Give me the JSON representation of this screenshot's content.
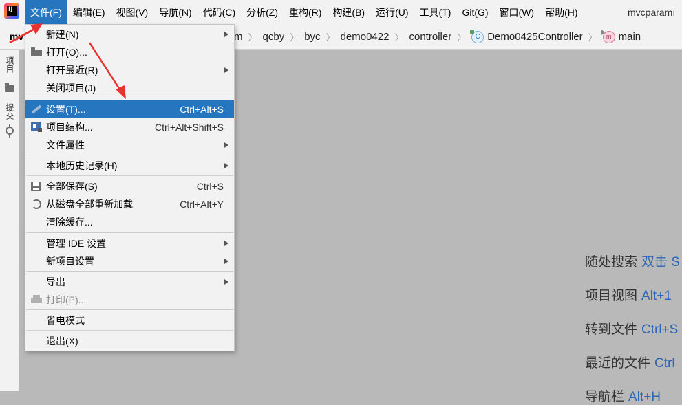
{
  "menubar": {
    "items": [
      "文件(F)",
      "编辑(E)",
      "视图(V)",
      "导航(N)",
      "代码(C)",
      "分析(Z)",
      "重构(R)",
      "构建(B)",
      "运行(U)",
      "工具(T)",
      "Git(G)",
      "窗口(W)",
      "帮助(H)"
    ],
    "active_index": 0,
    "project_name": "mvcparamı"
  },
  "breadcrumb": {
    "lead": "mv",
    "items": [
      "m",
      "qcby",
      "byc",
      "demo0422",
      "controller",
      "Demo0425Controller",
      "main"
    ]
  },
  "left_strip": {
    "project_tab": "项目",
    "commit_tab": "提交"
  },
  "file_menu": [
    {
      "label": "新建(N)",
      "submenu": true
    },
    {
      "label": "打开(O)...",
      "icon": "folder-open-icon"
    },
    {
      "label": "打开最近(R)",
      "submenu": true
    },
    {
      "label": "关闭项目(J)"
    },
    {
      "label": "设置(T)...",
      "shortcut": "Ctrl+Alt+S",
      "icon": "wrench-icon",
      "selected": true
    },
    {
      "label": "项目结构...",
      "shortcut": "Ctrl+Alt+Shift+S",
      "icon": "project-structure-icon"
    },
    {
      "label": "文件属性",
      "submenu": true
    },
    {
      "label": "本地历史记录(H)",
      "submenu": true
    },
    {
      "label": "全部保存(S)",
      "shortcut": "Ctrl+S",
      "icon": "save-icon"
    },
    {
      "label": "从磁盘全部重新加载",
      "shortcut": "Ctrl+Alt+Y",
      "icon": "reload-icon"
    },
    {
      "label": "清除缓存..."
    },
    {
      "label": "管理 IDE 设置",
      "submenu": true
    },
    {
      "label": "新项目设置",
      "submenu": true
    },
    {
      "label": "导出",
      "submenu": true
    },
    {
      "label": "打印(P)...",
      "icon": "print-icon",
      "disabled": true
    },
    {
      "label": "省电模式"
    },
    {
      "label": "退出(X)"
    }
  ],
  "hints": [
    {
      "text": "随处搜索",
      "key": "双击 S"
    },
    {
      "text": "项目视图",
      "key": "Alt+1"
    },
    {
      "text": "转到文件",
      "key": "Ctrl+S"
    },
    {
      "text": "最近的文件",
      "key": "Ctrl"
    },
    {
      "text": "导航栏",
      "key": "Alt+H"
    }
  ],
  "colors": {
    "accent": "#2675bf",
    "annotation": "#e8322f"
  }
}
